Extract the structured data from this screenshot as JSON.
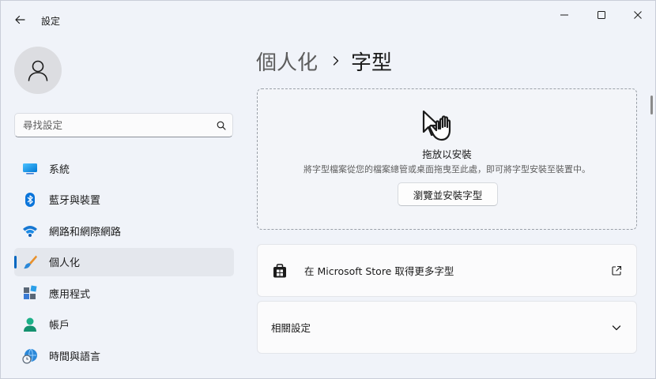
{
  "app": {
    "title": "設定"
  },
  "search": {
    "placeholder": "尋找設定"
  },
  "sidebar": {
    "items": [
      {
        "label": "系統",
        "icon": "system-icon"
      },
      {
        "label": "藍牙與裝置",
        "icon": "bluetooth-icon"
      },
      {
        "label": "網路和網際網路",
        "icon": "wifi-icon"
      },
      {
        "label": "個人化",
        "icon": "brush-icon",
        "active": true
      },
      {
        "label": "應用程式",
        "icon": "apps-icon"
      },
      {
        "label": "帳戶",
        "icon": "account-icon"
      },
      {
        "label": "時間與語言",
        "icon": "time-language-icon"
      }
    ]
  },
  "breadcrumb": {
    "parent": "個人化",
    "current": "字型"
  },
  "dropzone": {
    "title": "拖放以安裝",
    "description": "將字型檔案從您的檔案總管或桌面拖曳至此處，即可將字型安裝至裝置中。",
    "browse_label": "瀏覽並安裝字型"
  },
  "store_card": {
    "label": "在 Microsoft Store 取得更多字型"
  },
  "related_card": {
    "label": "相關設定"
  },
  "colors": {
    "accent": "#0067c0",
    "background": "#f0f3f9",
    "card": "#fbfbfc"
  }
}
